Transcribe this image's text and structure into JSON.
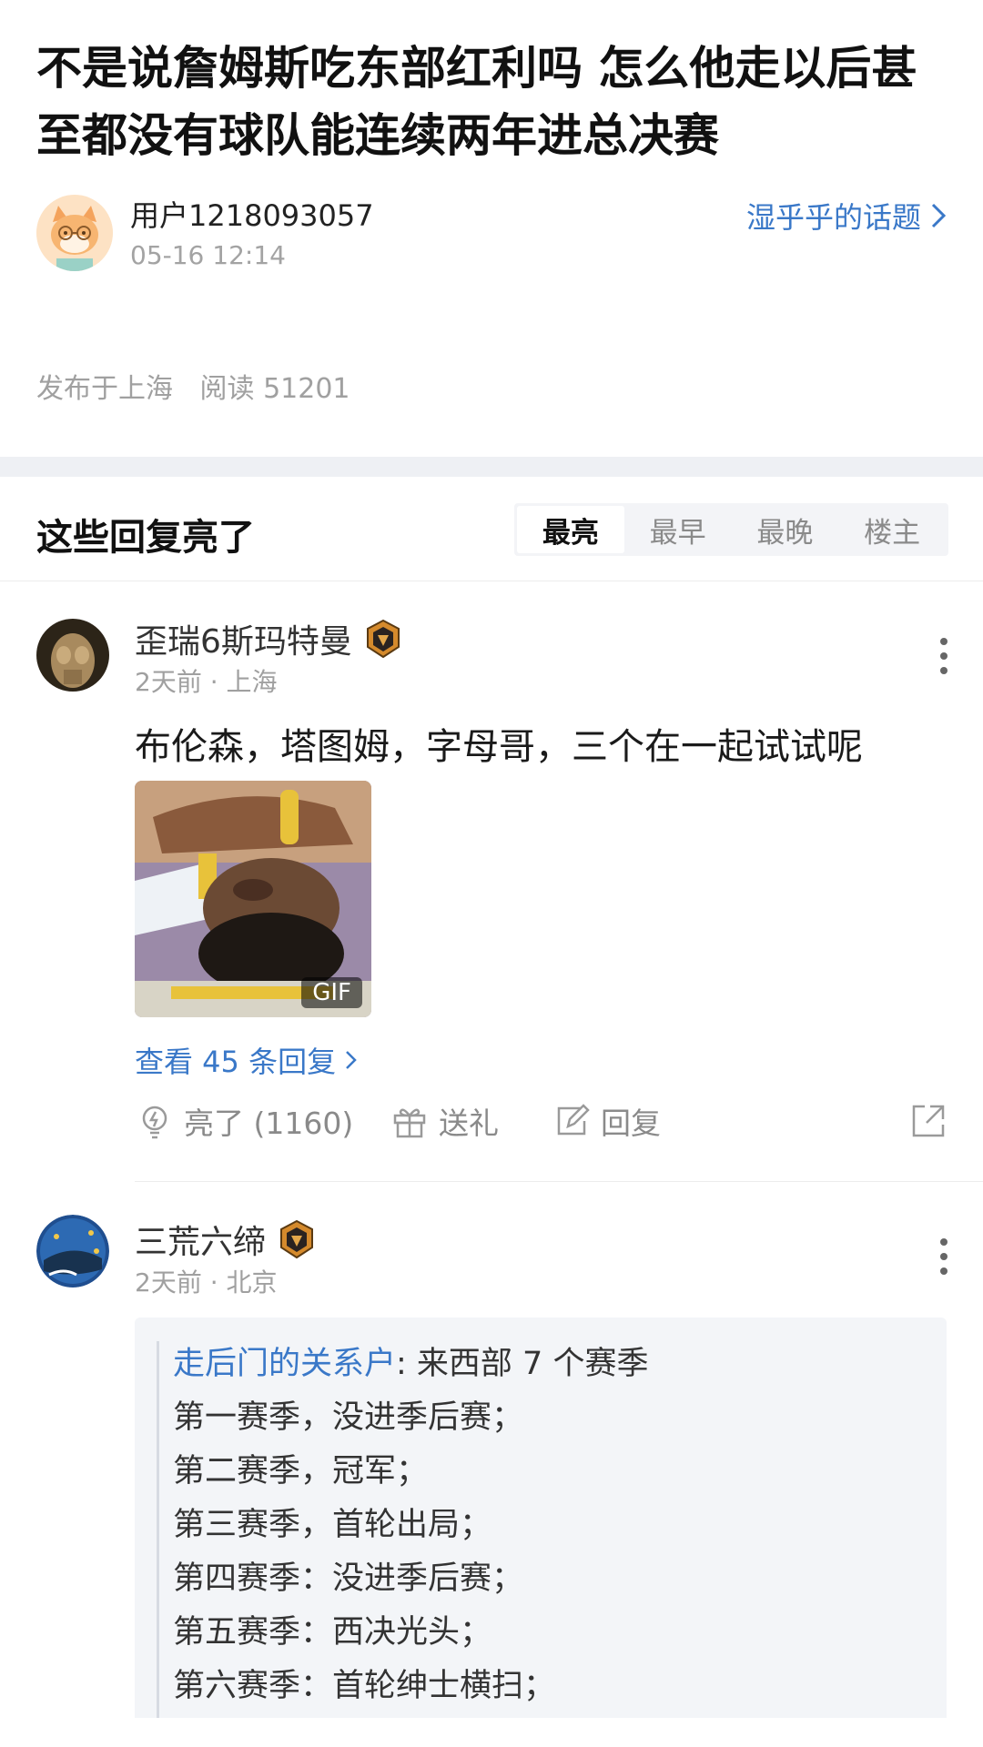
{
  "post": {
    "title": "不是说詹姆斯吃东部红利吗 怎么他走以后甚至都没有球队能连续两年进总决赛",
    "author": "用户1218093057",
    "time": "05-16 12:14",
    "topic_link": "湿乎乎的话题",
    "location": "发布于上海",
    "reads": "阅读 51201"
  },
  "replies_section": {
    "title": "这些回复亮了",
    "sort_tabs": [
      "最亮",
      "最早",
      "最晚",
      "楼主"
    ],
    "active_tab": "最亮"
  },
  "comments": [
    {
      "user": "歪瑞6斯玛特曼",
      "meta": "2天前 · 上海",
      "text": "布伦森，塔图姆，字母哥，三个在一起试试呢",
      "gif_label": "GIF",
      "view_replies": "查看 45 条回复",
      "like_label": "亮了 (1160)",
      "gift_label": "送礼",
      "reply_label": "回复"
    },
    {
      "user": "三荒六缔",
      "meta": "2天前 · 北京",
      "quote_user": "走后门的关系户",
      "quote_first": ": 来西部 7 个赛季",
      "quote_lines": [
        "第一赛季，没进季后赛；",
        "第二赛季，冠军；",
        "第三赛季，首轮出局；",
        "第四赛季：没进季后赛；",
        "第五赛季：西决光头；",
        "第六赛季：首轮绅士横扫；"
      ]
    }
  ],
  "colors": {
    "link": "#3a78c8",
    "muted": "#a0a0a0",
    "band": "#eef0f4",
    "quote_bg": "#f3f5f8",
    "badge": "#d58a2c"
  },
  "icons": [
    "more-icon",
    "chevron-right-icon",
    "lightbulb-icon",
    "gift-icon",
    "reply-icon",
    "share-icon",
    "badge-icon"
  ]
}
